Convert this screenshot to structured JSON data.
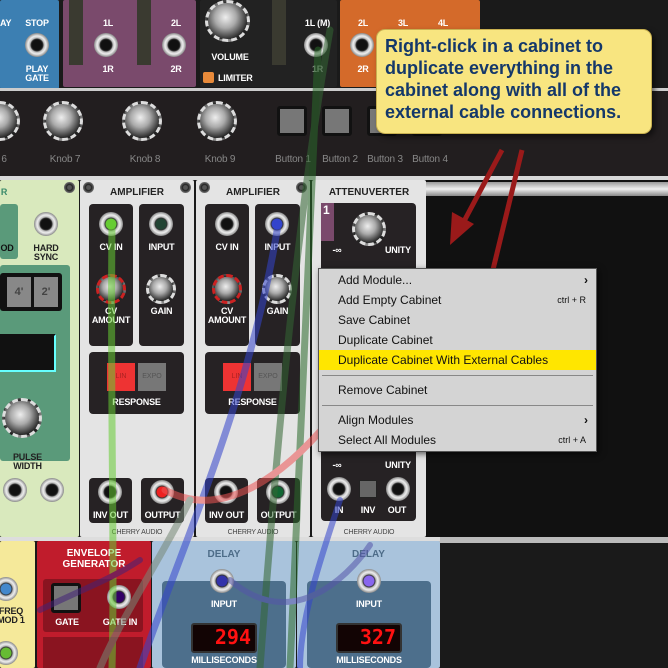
{
  "top_row": {
    "blue_module": {
      "labels": [
        "AY",
        "STOP",
        "PLAY\nGATE"
      ]
    },
    "purple_module": {
      "labels": [
        "1L",
        "2L",
        "1R",
        "2R"
      ]
    },
    "output_module": {
      "volume_label": "VOLUME",
      "limiter_label": "LIMITER",
      "jack_labels": [
        "1L (M)",
        "1R"
      ]
    },
    "orange_module": {
      "labels": [
        "2L",
        "3L",
        "4L",
        "2R"
      ]
    }
  },
  "controls_row": {
    "knobs": [
      "6",
      "Knob 7",
      "Knob 8",
      "Knob 9"
    ],
    "buttons": [
      "Button 1",
      "Button 2",
      "Button 3",
      "Button 4"
    ]
  },
  "oscillator": {
    "title_fragment": "R",
    "labels": [
      "OD",
      "HARD\nSYNC",
      "4'",
      "2'",
      "PULSE WIDTH"
    ]
  },
  "amplifiers": [
    {
      "title": "AMPLIFIER",
      "cv_in": "CV IN",
      "input": "INPUT",
      "cv_amount": "CV\nAMOUNT",
      "gain": "GAIN",
      "lin": "LIN",
      "expo": "EXPO",
      "response": "RESPONSE",
      "inv_out": "INV OUT",
      "output": "OUTPUT",
      "brand": "CHERRY AUDIO"
    },
    {
      "title": "AMPLIFIER",
      "cv_in": "CV IN",
      "input": "INPUT",
      "cv_amount": "CV\nAMOUNT",
      "gain": "GAIN",
      "lin": "LIN",
      "expo": "EXPO",
      "response": "RESPONSE",
      "inv_out": "INV OUT",
      "output": "OUTPUT",
      "brand": "CHERRY AUDIO"
    }
  ],
  "attenuverter": {
    "title": "ATTENUVERTER",
    "channel": "1",
    "neg_inf": "-∞",
    "unity": "UNITY",
    "in": "IN",
    "inv": "INV",
    "out": "OUT",
    "brand": "CHERRY AUDIO"
  },
  "bottom_row": {
    "yellow_module": {
      "label": "FREQ\nMOD 1"
    },
    "envelope": {
      "title": "ENVELOPE\nGENERATOR",
      "gate": "GATE",
      "gate_in": "GATE IN"
    },
    "delays": [
      {
        "title": "DELAY",
        "input": "INPUT",
        "value": "294",
        "unit": "MILLISECONDS"
      },
      {
        "title": "DELAY",
        "input": "INPUT",
        "value": "327",
        "unit": "MILLISECONDS"
      }
    ]
  },
  "tooltip": {
    "text": "Right-click in a cabinet to duplicate everything in the cabinet along with all of the external cable connections."
  },
  "context_menu": {
    "items": [
      {
        "label": "Add Module...",
        "submenu": true
      },
      {
        "label": "Add Empty Cabinet",
        "shortcut": "ctrl + R"
      },
      {
        "label": "Save Cabinet"
      },
      {
        "label": "Duplicate Cabinet"
      },
      {
        "label": "Duplicate Cabinet With External Cables",
        "highlighted": true
      },
      {
        "label": "Remove Cabinet"
      },
      {
        "label": "Align Modules",
        "submenu": true
      },
      {
        "label": "Select All Modules",
        "shortcut": "ctrl + A"
      }
    ],
    "highlight_color": "#ffe600"
  },
  "colors": {
    "tooltip_bg": "#f8e580",
    "tooltip_text": "#14386a",
    "arrow": "#9a1a1a"
  }
}
